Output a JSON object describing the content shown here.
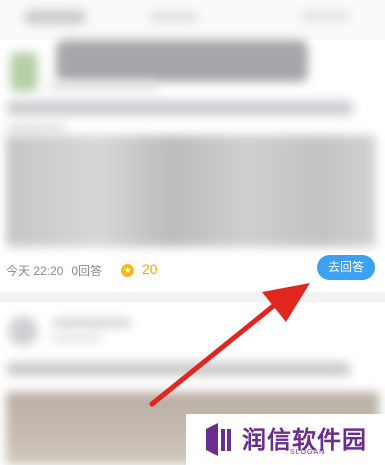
{
  "feed": {
    "question": {
      "time": "今天 22:20",
      "answer_count": "0回答",
      "reward": "20",
      "answer_button": "去回答"
    }
  },
  "watermark": {
    "brand": "润信软件园",
    "slogan": "SLOGAN"
  },
  "colors": {
    "accent_blue": "#3da1f1",
    "reward_gold": "#f0a800",
    "arrow_red": "#e0261f",
    "brand_purple": "#6b2c8f"
  }
}
